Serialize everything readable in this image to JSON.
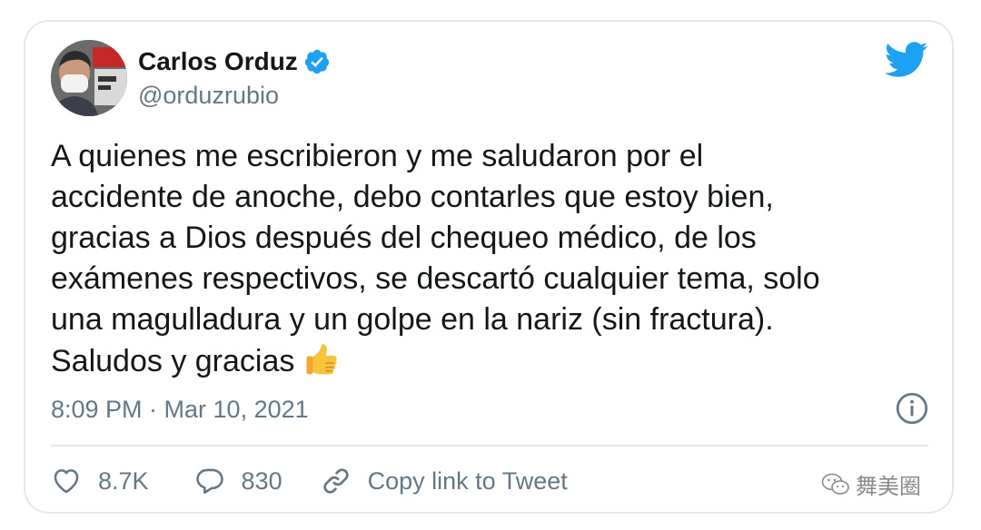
{
  "author": {
    "name": "Carlos Orduz",
    "handle": "@orduzrubio",
    "verified": true
  },
  "tweet": {
    "text": "A quienes me escribieron  y me saludaron por el\naccidente de anoche, debo contarles que estoy bien,\ngracias a Dios después del chequeo médico, de los\nexámenes respectivos, se descartó cualquier tema, solo\nuna magulladura y un golpe en la nariz (sin fractura).\nSaludos y gracias",
    "emoji": "thumbs-up",
    "timestamp": "8:09 PM · Mar 10, 2021"
  },
  "actions": {
    "likes": "8.7K",
    "replies": "830",
    "copy_link_label": "Copy link to Tweet"
  },
  "watermark": {
    "text": "舞美圈"
  },
  "icons": {
    "verified": "verified-badge-icon",
    "logo": "twitter-bird-icon",
    "info": "info-icon",
    "like": "heart-icon",
    "reply": "speech-bubble-icon",
    "copy_link": "link-icon",
    "watermark": "wechat-icon"
  },
  "colors": {
    "twitter_blue": "#1da1f2",
    "text_primary": "#14171a",
    "text_secondary": "#657786",
    "border": "#e1e8ed"
  }
}
